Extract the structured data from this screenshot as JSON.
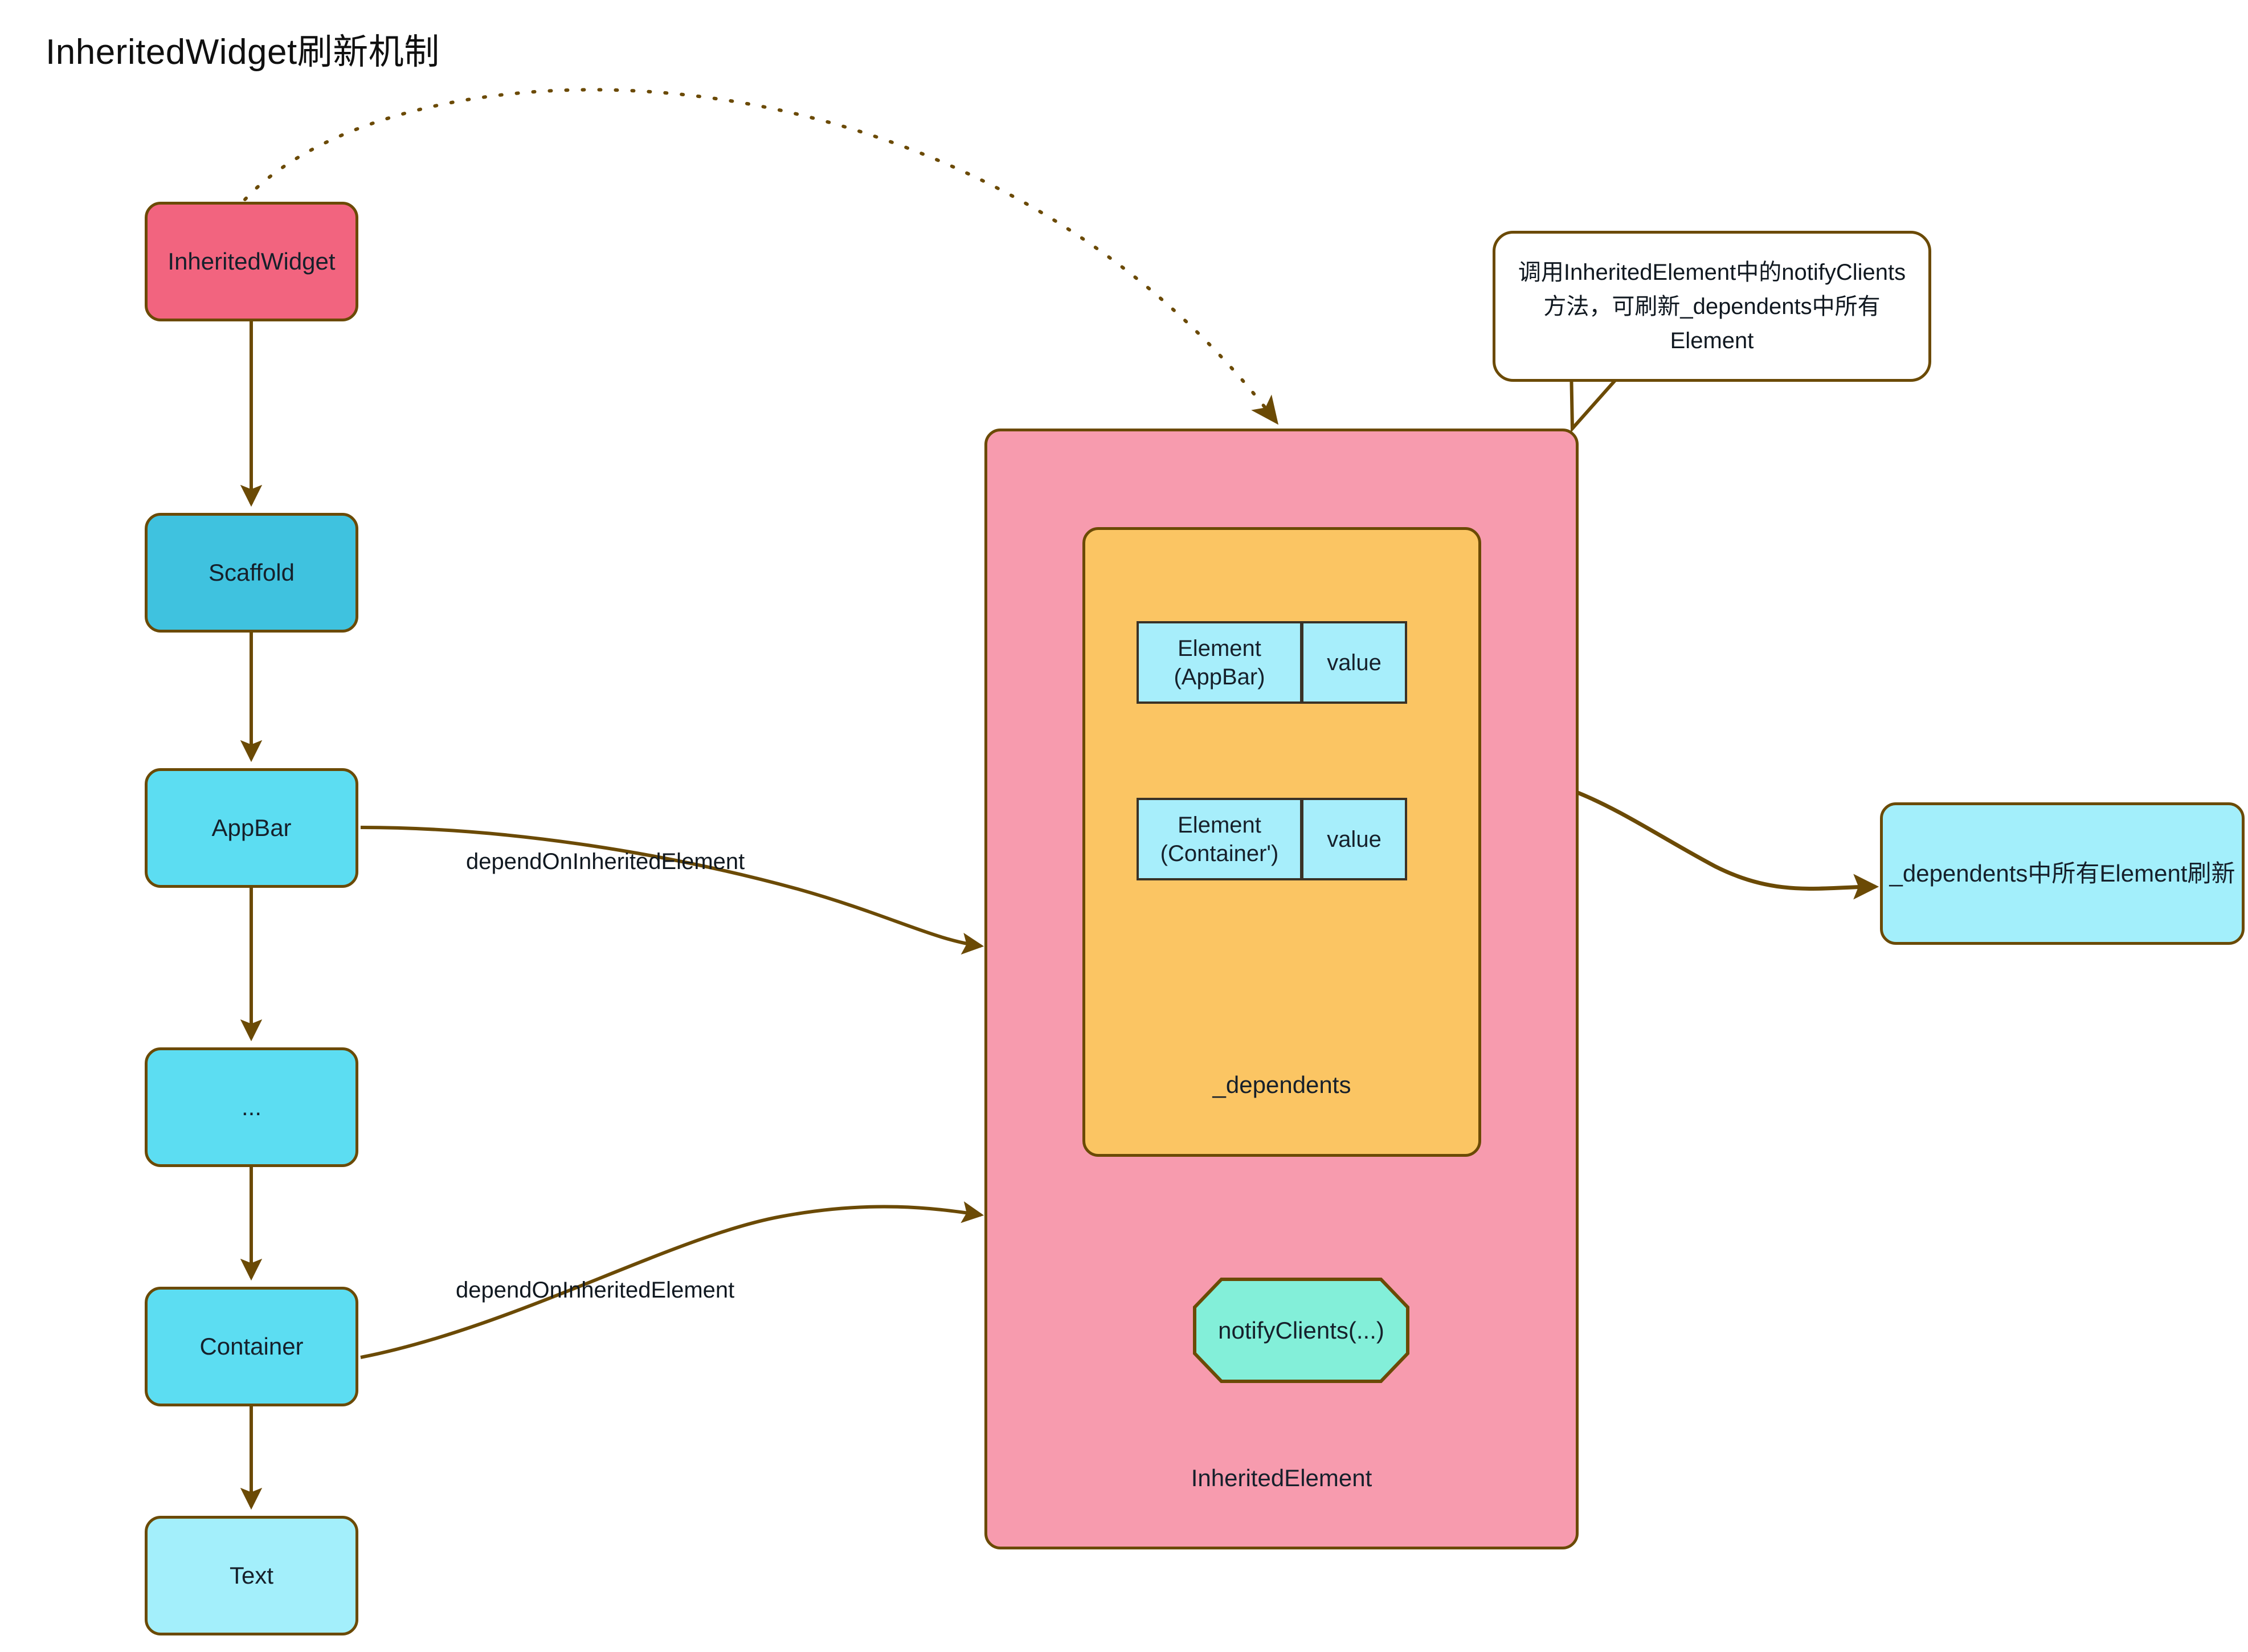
{
  "diagram": {
    "title": "InheritedWidget刷新机制",
    "background": "#FFFFFF",
    "stroke_color": "#6B4A05"
  },
  "widget_tree": {
    "nodes": [
      {
        "id": "inheritedwidget",
        "label": "InheritedWidget",
        "color": "#F2647F",
        "shape": "rounded-rect"
      },
      {
        "id": "scaffold",
        "label": "Scaffold",
        "color": "#3FC2DF",
        "shape": "rounded-rect"
      },
      {
        "id": "appbar",
        "label": "AppBar",
        "color": "#5CDDF2",
        "shape": "rounded-rect"
      },
      {
        "id": "ellipsis",
        "label": "...",
        "color": "#5CDDF2",
        "shape": "rounded-rect"
      },
      {
        "id": "container",
        "label": "Container",
        "color": "#5CDDF2",
        "shape": "rounded-rect"
      },
      {
        "id": "text",
        "label": "Text",
        "color": "#A3EFFB",
        "shape": "rounded-rect"
      }
    ]
  },
  "inherited_element": {
    "label": "InheritedElement",
    "color": "#F79BAE",
    "dependents": {
      "label": "_dependents",
      "color": "#FBC563",
      "rows": [
        {
          "key": "Element\n(AppBar)",
          "key_line1": "Element",
          "key_line2": "(AppBar)",
          "value": "value",
          "color": "#A7EEFB"
        },
        {
          "key": "Element\n(Container')",
          "key_line1": "Element",
          "key_line2": "(Container')",
          "value": "value",
          "color": "#A7EEFB"
        }
      ]
    },
    "notify_clients": {
      "label": "notifyClients(...)",
      "color": "#83EFD9",
      "shape": "octagon"
    }
  },
  "callout": {
    "text": "调用InheritedElement中的notifyClients方法，可刷新_dependents中所有Element",
    "shape": "speech-bubble",
    "color": "#FFFFFF"
  },
  "refresh_result": {
    "label": "_dependents中所有Element刷新",
    "color": "#A3EFFB",
    "shape": "rounded-rect"
  },
  "edge_labels": {
    "depend_on_inherited_element_1": "dependOnInheritedElement",
    "depend_on_inherited_element_2": "dependOnInheritedElement"
  }
}
